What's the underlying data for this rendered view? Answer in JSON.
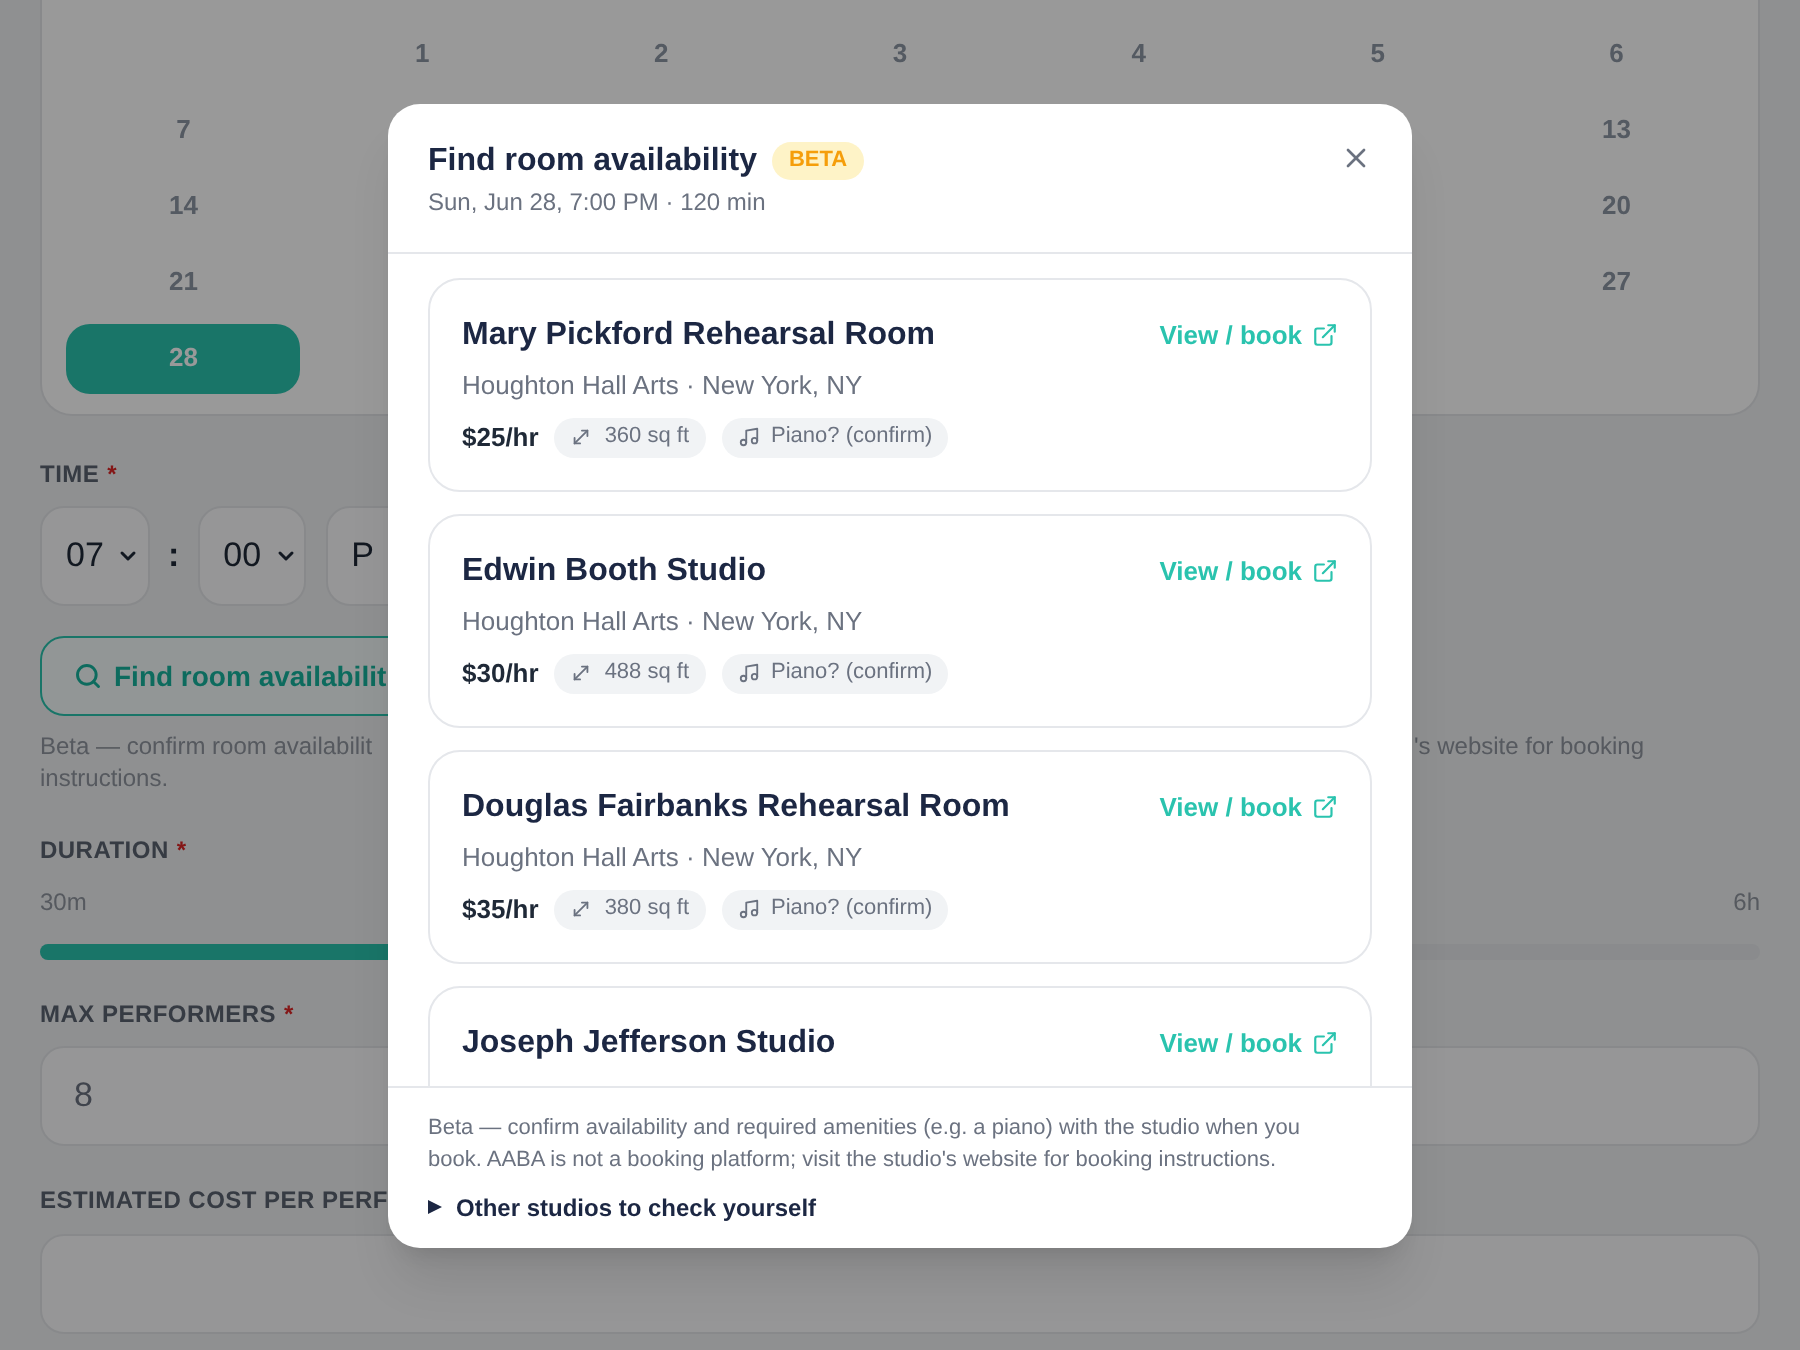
{
  "calendar": {
    "weeks": [
      {
        "right_days": [
          {
            "label": "1",
            "selected": false
          },
          {
            "label": "2",
            "selected": false
          },
          {
            "label": "3",
            "selected": false
          },
          {
            "label": "4",
            "selected": false
          },
          {
            "label": "5",
            "selected": false
          },
          {
            "label": "6",
            "selected": false
          }
        ]
      },
      {
        "left_days": [
          {
            "label": "7",
            "selected": false
          }
        ],
        "right_days": [
          {
            "label": "13",
            "selected": false
          }
        ]
      },
      {
        "left_days": [
          {
            "label": "14",
            "selected": false
          }
        ],
        "right_days": [
          {
            "label": "20",
            "selected": false
          }
        ]
      },
      {
        "left_days": [
          {
            "label": "21",
            "selected": false
          }
        ],
        "right_days": [
          {
            "label": "27",
            "selected": false
          }
        ]
      },
      {
        "left_days": [
          {
            "label": "28",
            "selected": true
          }
        ]
      }
    ]
  },
  "form": {
    "time": {
      "label": "TIME",
      "required_mark": "*",
      "hour": "07",
      "separator": ":",
      "minute": "00",
      "period": "P"
    },
    "find_button": {
      "label": "Find room availabilit"
    },
    "beta_note": {
      "left_lines": [
        "Beta — confirm room availabilit",
        "instructions."
      ],
      "right_text": "'s website for booking"
    },
    "duration": {
      "label": "DURATION",
      "required_mark": "*",
      "min_label": "30m",
      "max_label": "6h",
      "level": 0.27
    },
    "max_performers": {
      "label": "MAX PERFORMERS",
      "required_mark": "*",
      "value": "8"
    },
    "estimated_cost": {
      "label": "ESTIMATED COST PER PERF"
    }
  },
  "modal": {
    "title": "Find room availability",
    "badge": "BETA",
    "subtitle": "Sun, Jun 28, 7:00 PM · 120 min",
    "rooms": [
      {
        "name": "Mary Pickford Rehearsal Room",
        "link": "View / book",
        "venue": "Houghton Hall Arts · New York, NY",
        "price": "$25/hr",
        "size": "360 sq ft",
        "amenity": "Piano? (confirm)"
      },
      {
        "name": "Edwin Booth Studio",
        "link": "View / book",
        "venue": "Houghton Hall Arts · New York, NY",
        "price": "$30/hr",
        "size": "488 sq ft",
        "amenity": "Piano? (confirm)"
      },
      {
        "name": "Douglas Fairbanks Rehearsal Room",
        "link": "View / book",
        "venue": "Houghton Hall Arts · New York, NY",
        "price": "$35/hr",
        "size": "380 sq ft",
        "amenity": "Piano? (confirm)"
      },
      {
        "name": "Joseph Jefferson Studio",
        "link": "View / book"
      }
    ],
    "footer_note": "Beta — confirm availability and required amenities (e.g. a piano) with the studio when you book. AABA is not a booking platform; visit the studio's website for booking instructions.",
    "disclosure": {
      "label": "Other studios to check yourself",
      "expanded": false
    }
  }
}
